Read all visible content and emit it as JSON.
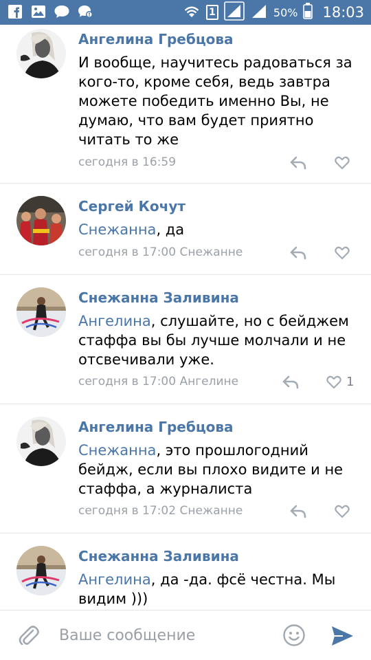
{
  "status_bar": {
    "battery": "50%",
    "time": "18:03",
    "sim_number": "1",
    "icons": [
      "facebook-icon",
      "gallery-icon",
      "chat-icon",
      "messenger-icon",
      "wifi-icon",
      "signal-icon",
      "battery-icon"
    ]
  },
  "comments": [
    {
      "author": "Ангелина Гребцова",
      "text": "И вообще, научитесь радоваться за кого-то, кроме себя, ведь завтра можете победить именно Вы, не думаю, что вам будет приятно читать то же",
      "mention": "",
      "meta": "сегодня в 16:59",
      "likes": ""
    },
    {
      "author": "Сергей Кочут",
      "mention": "Снежанна",
      "text": ", да",
      "meta": "сегодня в 17:00 Снежанне",
      "likes": ""
    },
    {
      "author": "Снежанна Заливина",
      "mention": "Ангелина",
      "text": ", слушайте, но с бейджем стаффа вы бы лучше молчали и не отсвечивали уже.",
      "meta": "сегодня в 17:00 Ангелине",
      "likes": "1"
    },
    {
      "author": "Ангелина Гребцова",
      "mention": "Снежанна",
      "text": ", это прошлогодний бейдж, если вы плохо видите и не стаффа, а журналиста",
      "meta": "сегодня в 17:02 Снежанне",
      "likes": ""
    },
    {
      "author": "Снежанна Заливина",
      "mention": "Ангелина",
      "text": ", да -да. фсё честна. Мы видим )))",
      "meta": "",
      "likes": ""
    }
  ],
  "input": {
    "placeholder": "Ваше сообщение"
  },
  "colors": {
    "accent": "#4a76a8",
    "meta_text": "#9aa1a9",
    "divider": "#e3e6ea"
  }
}
